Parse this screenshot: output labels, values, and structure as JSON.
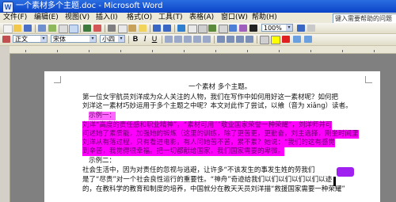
{
  "window": {
    "title": "一个素材多个主题.doc - Microsoft Word",
    "app_icon": "W"
  },
  "menu": {
    "items": [
      "文件(F)",
      "编辑(E)",
      "视图(V)",
      "插入(I)",
      "格式(O)",
      "工具(T)",
      "表格(A)",
      "窗口(W)",
      "帮助(H)"
    ],
    "help_placeholder": "键入需要帮助的问题"
  },
  "toolbar": {
    "zoom": "100%",
    "style": "正文",
    "font": "宋体",
    "size": "小四",
    "bold": "B",
    "italic": "I",
    "underline": "U"
  },
  "document": {
    "title": "一个素材  多个主题。",
    "para1_l1": "  第一位女宇航员刘洋成为众人关注的人物，我们在写作中如何用好这一素材呢？如何把",
    "para1_l2": "刘洋这一素材巧妙运用于多个主题之中呢？本文对此作了尝试，以飨（音为 xiǎng）读者。",
    "example1_label": "示例一：",
    "hl_l1": "  刘洋“高度的责任感和职业精神”，“素材可用”“敬业国家荣誉一种荣耀”，刘洋师并可",
    "hl_l2": "问述她了素质能，加强她的锻炼（这里的训练，除了更苦更，更勤奋，刘主选择，刚坐时间里",
    "hl_l3": "刘洋从有落过程，只有看进电影，有人问她苦不苦，累不累？她说：“我们的这有感觉",
    "hl_l4": "到辛苦，我觉得很幸福。把一切都献给国家，我们国家需要的卑微。",
    "example2_label": "示例二：",
    "para3_l1": "  社会生活中，因为对责任的忽视与逃避，让许多“不该发生的事发生姓的劳我们",
    "para3_l2": "是了“尽责”对一个社会良性运行的重要性。“神舟”奇迹给我们以们以们以们以们以迹",
    "para3_l3": "的，在教科学的教育和制度的培养，中国就分在教天天员刘洋描“救援国家需要一种荣耀”"
  },
  "colors": {
    "highlight": "#ff00ff",
    "titlebar": "#0a43c8",
    "chrome": "#ece9d8",
    "workspace": "#808080"
  }
}
